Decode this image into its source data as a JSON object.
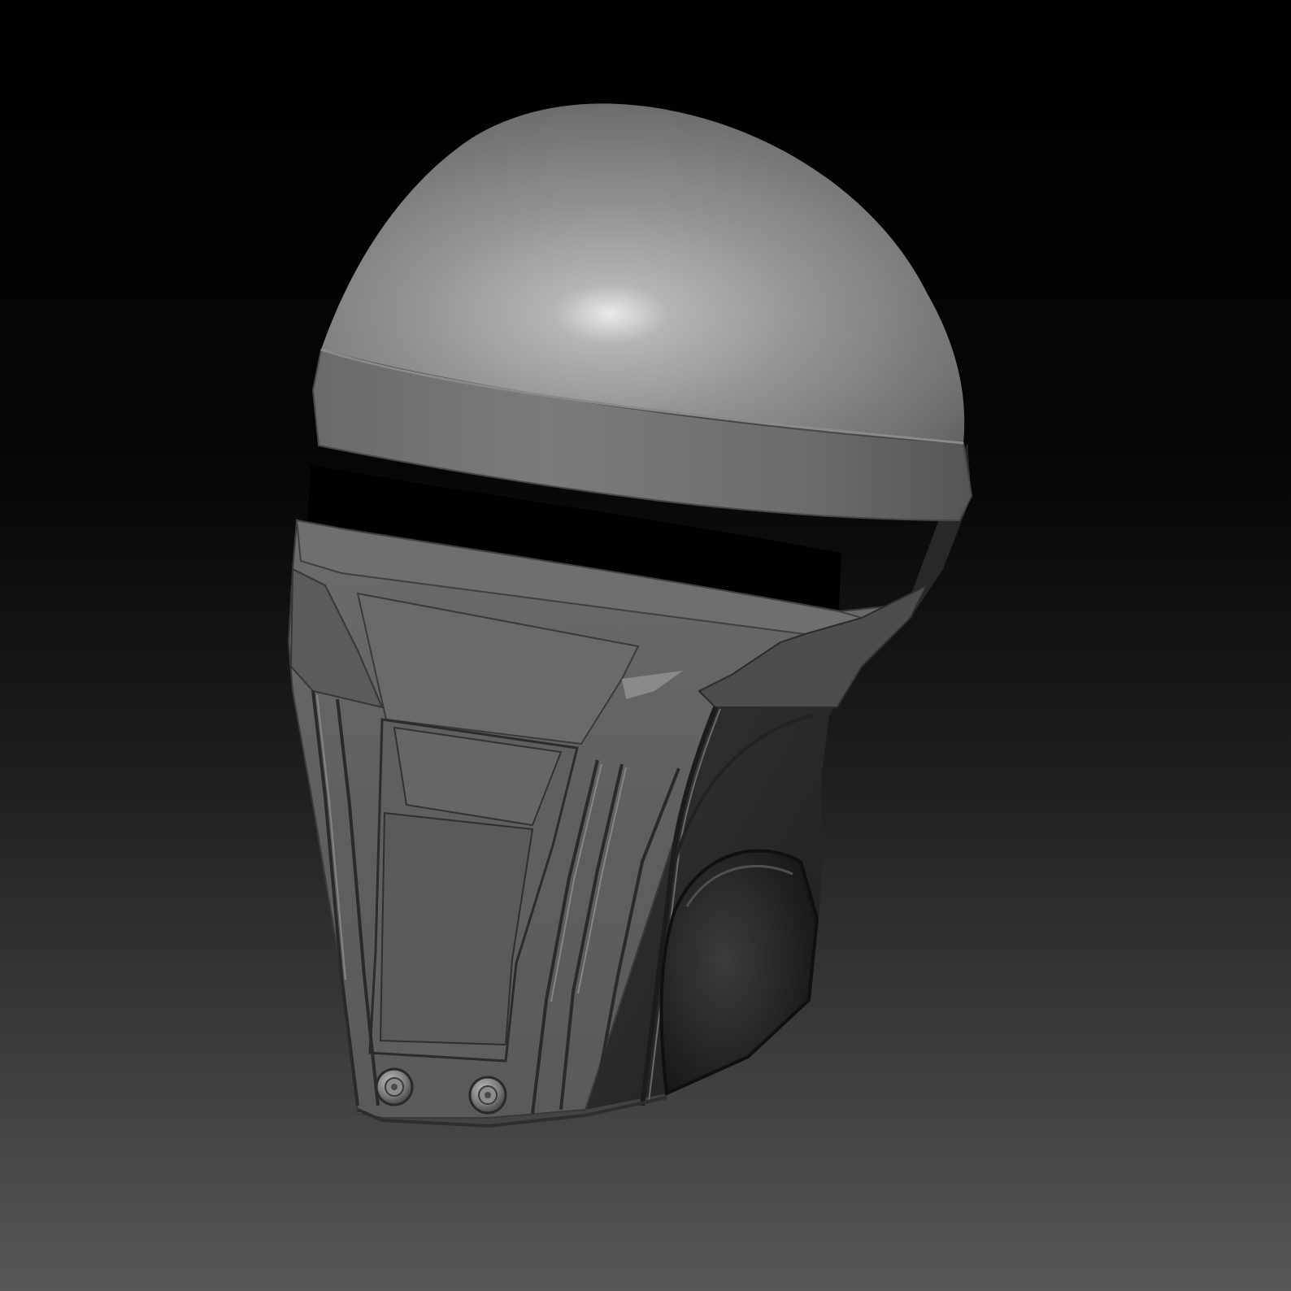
{
  "scene": {
    "subject": "helmet-3d-render",
    "colors": {
      "background_top": "#000000",
      "background_bottom": "#575757",
      "material_light": "#9a9a9a",
      "material_mid": "#6e6e6e",
      "material_dark": "#2a2a2a",
      "visor_slot": "#000000"
    }
  }
}
